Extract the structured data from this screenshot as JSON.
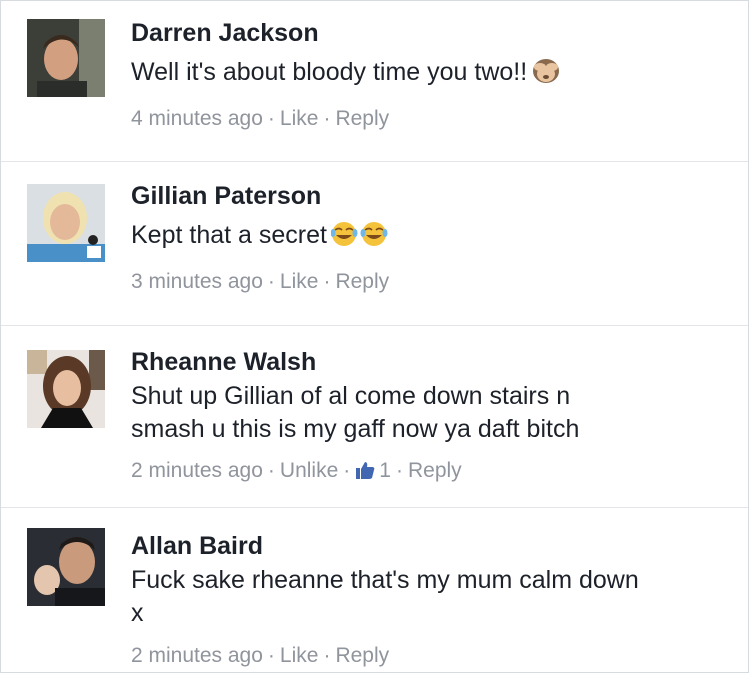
{
  "comments": [
    {
      "name": "Darren Jackson",
      "text": "Well it's about bloody time you two!!",
      "emoji": "see-no-evil-monkey-icon",
      "time": "4 minutes ago",
      "like_label": "Like",
      "reply_label": "Reply"
    },
    {
      "name": "Gillian Paterson",
      "text": "Kept that a secret",
      "emoji": "tears-of-joy-icon",
      "time": "3 minutes ago",
      "like_label": "Like",
      "reply_label": "Reply"
    },
    {
      "name": "Rheanne Walsh",
      "text_line1": "Shut up Gillian of al come down stairs n",
      "text_line2": "smash u this is my gaff now ya daft bitch",
      "time": "2 minutes ago",
      "like_label": "Unlike",
      "like_count": "1",
      "reply_label": "Reply"
    },
    {
      "name": "Allan Baird",
      "text_line1": "Fuck sake rheanne that's my mum calm down",
      "text_line2": "x",
      "time": "2 minutes ago",
      "like_label": "Like",
      "reply_label": "Reply"
    }
  ],
  "separator": "·",
  "colors": {
    "meta": "#90949c",
    "name": "#1d2129",
    "like_blue": "#4267b2"
  }
}
